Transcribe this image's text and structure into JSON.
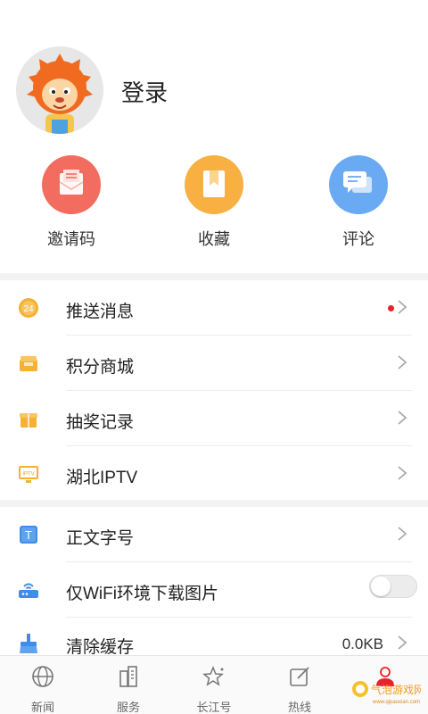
{
  "profile": {
    "login_label": "登录",
    "avatar": "cartoon-lion-avatar"
  },
  "quick_actions": [
    {
      "label": "邀请码",
      "icon": "envelope-icon",
      "color": "#f26d5f"
    },
    {
      "label": "收藏",
      "icon": "bookmark-icon",
      "color": "#f7b041"
    },
    {
      "label": "评论",
      "icon": "chat-icon",
      "color": "#6aaaf2"
    }
  ],
  "menu_group_1": [
    {
      "label": "推送消息",
      "icon": "push-24-icon",
      "has_dot": true
    },
    {
      "label": "积分商城",
      "icon": "shop-icon"
    },
    {
      "label": "抽奖记录",
      "icon": "gift-icon"
    },
    {
      "label": "湖北IPTV",
      "icon": "iptv-icon",
      "icon_text": "IPTV"
    }
  ],
  "menu_group_2": [
    {
      "label": "正文字号",
      "icon": "font-size-icon",
      "icon_text": "T"
    },
    {
      "label": "仅WiFi环境下载图片",
      "icon": "router-icon",
      "toggle_on": false
    },
    {
      "label": "清除缓存",
      "icon": "broom-icon",
      "value": "0.0KB"
    }
  ],
  "push_badge_text": "24",
  "tabbar": [
    {
      "label": "新闻",
      "icon": "globe-icon"
    },
    {
      "label": "服务",
      "icon": "building-icon"
    },
    {
      "label": "长江号",
      "icon": "star-icon"
    },
    {
      "label": "热线",
      "icon": "edit-icon"
    },
    {
      "label": "",
      "icon": "user-icon",
      "active": true
    }
  ],
  "watermark": {
    "text": "气泡游戏网",
    "sub": "www.qipaoxian.com"
  },
  "colors": {
    "accent_red": "#e8212b",
    "divider": "#ececec",
    "section_gap": "#f3f3f3"
  }
}
